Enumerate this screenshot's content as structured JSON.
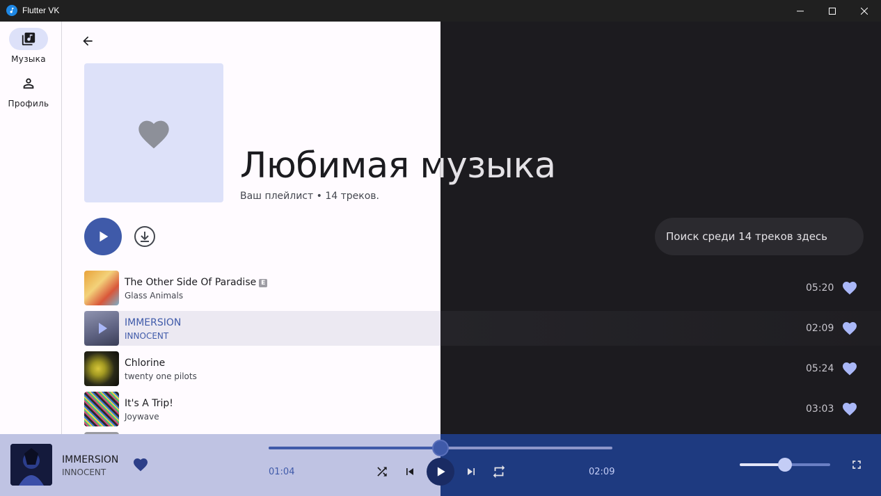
{
  "window": {
    "title": "Flutter VK"
  },
  "rail": {
    "items": [
      {
        "label": "Музыка",
        "icon": "library-music-icon",
        "selected": true
      },
      {
        "label": "Профиль",
        "icon": "person-icon",
        "selected": false
      }
    ]
  },
  "playlist": {
    "title": "Любимая музыка",
    "subtitle": "Ваш плейлист • 14 треков.",
    "search_placeholder": "Поиск среди 14 треков здесь"
  },
  "tracks": [
    {
      "title": "The Other Side Of Paradise",
      "artist": "Glass Animals",
      "duration": "05:20",
      "explicit_badge": "E",
      "active": false
    },
    {
      "title": "IMMERSION",
      "artist": "INNOCENT",
      "duration": "02:09",
      "active": true
    },
    {
      "title": "Chlorine",
      "artist": "twenty one pilots",
      "duration": "05:24",
      "active": false
    },
    {
      "title": "It's A Trip!",
      "artist": "Joywave",
      "duration": "03:03",
      "active": false
    }
  ],
  "player": {
    "title": "IMMERSION",
    "artist": "INNOCENT",
    "elapsed": "01:04",
    "total": "02:09",
    "progress": 0.5,
    "volume": 0.5,
    "liked": true
  },
  "colors": {
    "accent": "#3f5aa9",
    "heart": "#aab8f8",
    "light_bg": "#fffbff",
    "dark_bg": "#1c1b1f",
    "player_light": "#bfc3e3",
    "player_dark": "#1e3a80"
  }
}
